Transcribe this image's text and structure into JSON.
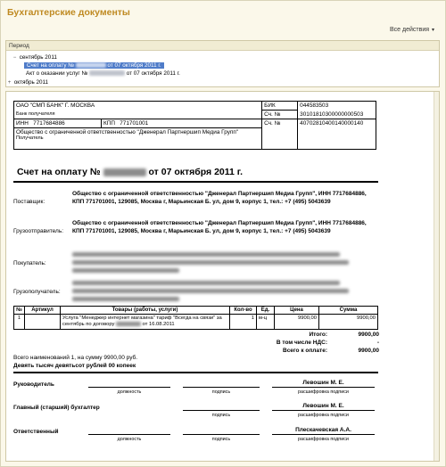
{
  "window": {
    "title": "Бухгалтерские документы",
    "actions_label": "Все действия",
    "actions_arrow": "▾"
  },
  "tree": {
    "header": "Период",
    "items": [
      {
        "level": 0,
        "expander": "−",
        "text": "сентябрь 2011",
        "selected": false
      },
      {
        "level": 1,
        "expander": "",
        "text_prefix": "Счет на оплату №",
        "text_suffix": "от 07 октября 2011 г.",
        "selected": true
      },
      {
        "level": 1,
        "expander": "",
        "text_prefix": "Акт о оказании услуг №",
        "text_suffix": "от 07 октября 2011 г.",
        "selected": false
      },
      {
        "level": 0,
        "expander": "+",
        "text": "октябрь 2011",
        "selected": false
      }
    ]
  },
  "bank": {
    "bank_name": "ОАО \"СМП БАНК\" Г. МОСКВА",
    "bank_caption": "Банк получателя",
    "bik_label": "БИК",
    "bik_value": "044583503",
    "corr_label": "Сч. №",
    "corr_value": "30101810300000000503",
    "inn_label": "ИНН",
    "inn_value": "7717684886",
    "kpp_label": "КПП",
    "kpp_value": "771701001",
    "recipient_name": "Общество с ограниченной ответственностью \"Дженерал Партнершип Медиа Групп\"",
    "recipient_caption": "Получатель",
    "acc_label": "Сч. №",
    "acc_value": "40702810400140000140"
  },
  "invoice": {
    "title_prefix": "Счет на оплату №",
    "title_suffix": "от 07 октября 2011 г."
  },
  "parties": [
    {
      "label": "Поставщик:",
      "value": "Общество с ограниченной ответственностью \"Дженерал Партнершип Медиа Групп\", ИНН 7717684886, КПП 771701001, 129085, Москва г, Марьинская Б. ул, дом 9, корпус 1, тел.: +7 (495) 5043639",
      "blurred": false
    },
    {
      "label": "Грузоотправитель:",
      "value": "Общество с ограниченной ответственностью \"Дженерал Партнершип Медиа Групп\", ИНН 7717684886, КПП 771701001, 129085, Москва г, Марьинская Б. ул, дом 9, корпус 1, тел.: +7 (495) 5043639",
      "blurred": false
    },
    {
      "label": "Покупатель:",
      "value": "",
      "blurred": true
    },
    {
      "label": "Грузополучатель:",
      "value": "",
      "blurred": true
    }
  ],
  "goods": {
    "headers": [
      "№",
      "Артикул",
      "Товары (работы, услуги)",
      "Кол-во",
      "Ед.",
      "Цена",
      "Сумма"
    ],
    "rows": [
      {
        "num": "1",
        "article": "",
        "name_prefix": "Услуга \"Менеджер интернет магазина\" тариф \"Всегда на связи\" за сентябрь по договору",
        "name_suffix": "от 16.08.2011",
        "qty": "1",
        "unit": "м-ц",
        "price": "9900,00",
        "sum": "9900,00"
      }
    ]
  },
  "totals": [
    {
      "label": "Итого:",
      "value": "9900,00"
    },
    {
      "label": "В том числе НДС:",
      "value": "-"
    },
    {
      "label": "Всего к оплате:",
      "value": "9900,00"
    }
  ],
  "summary": {
    "line1": "Всего наименований 1, на сумму 9900,00 руб.",
    "line2": "Девять тысяч девятьсот рублей 00 копеек"
  },
  "signatures": [
    {
      "role": "Руководитель",
      "position_caption": "должность",
      "sign_caption": "подпись",
      "name": "Левошин М. Е.",
      "name_caption": "расшифровка подписи"
    },
    {
      "role": "Главный (старший) бухгалтер",
      "position_caption": "",
      "sign_caption": "подпись",
      "name": "Левошин М. Е.",
      "name_caption": "расшифровка подписи"
    },
    {
      "role": "Ответственный",
      "position_caption": "должность",
      "sign_caption": "подпись",
      "name": "Плескачевская А.А.",
      "name_caption": "расшифровка подписи"
    }
  ]
}
